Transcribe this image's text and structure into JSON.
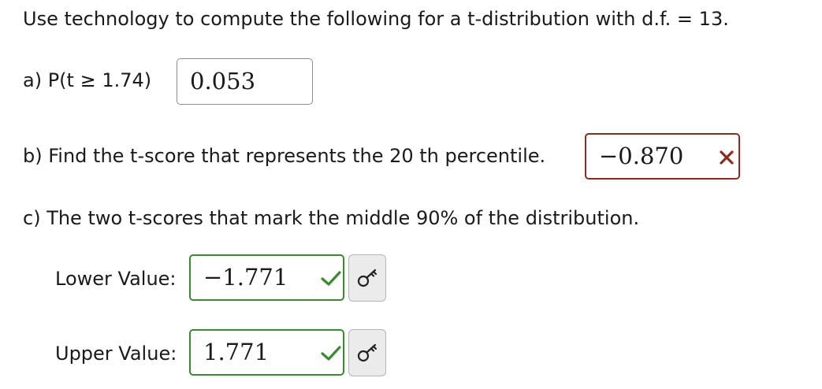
{
  "instructions": "Use technology to compute the following for a t-distribution with d.f. = 13.",
  "part_a": {
    "label": "a) P(t ≥ 1.74)",
    "answer": "0.053"
  },
  "part_b": {
    "label": "b) Find the t-score that represents the 20 th percentile.",
    "answer": "−0.870",
    "status": "incorrect"
  },
  "part_c": {
    "label": "c) The two t-scores that mark the middle 90% of the distribution.",
    "lower_label": "Lower Value:",
    "lower_answer": "−1.771",
    "lower_status": "correct",
    "upper_label": "Upper Value:",
    "upper_answer": "1.771",
    "upper_status": "correct"
  },
  "colors": {
    "correct": "#3a8a2f",
    "incorrect": "#8b2b22"
  },
  "icons": {
    "correct": "checkmark-icon",
    "incorrect": "x-mark-icon",
    "key": "key-icon"
  }
}
